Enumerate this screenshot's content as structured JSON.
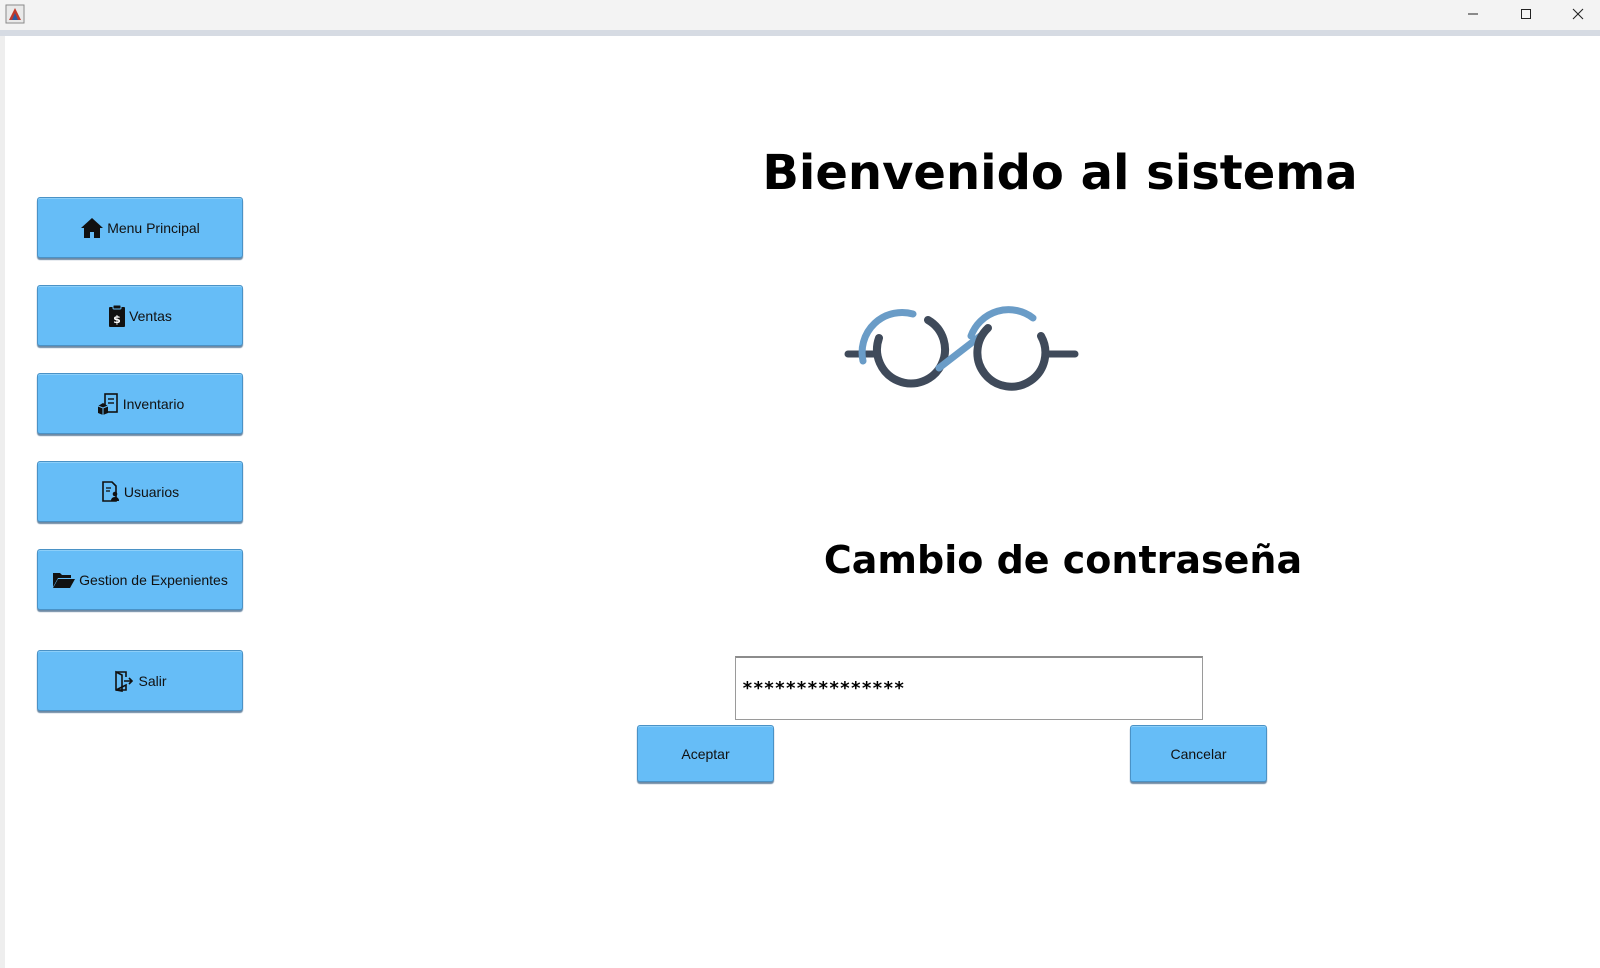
{
  "window": {
    "icons": {
      "app": "java-app-icon",
      "minimize": "minimize-icon",
      "maximize": "maximize-icon",
      "close": "close-icon"
    }
  },
  "sidebar": {
    "items": [
      {
        "label": "Menu Principal",
        "icon": "home-icon"
      },
      {
        "label": "Ventas",
        "icon": "clipboard-dollar-icon"
      },
      {
        "label": "Inventario",
        "icon": "inventory-icon"
      },
      {
        "label": "Usuarios",
        "icon": "user-document-icon"
      },
      {
        "label": "Gestion de Expenientes",
        "icon": "folder-open-icon"
      },
      {
        "label": "Salir",
        "icon": "exit-door-icon"
      }
    ]
  },
  "main": {
    "welcome_title": "Bienvenido al sistema",
    "logo_icon": "glasses-logo-icon",
    "section_title": "Cambio de contraseña",
    "password_value": "***************",
    "accept_label": "Aceptar",
    "cancel_label": "Cancelar"
  },
  "colors": {
    "button_fill": "#66bdf7",
    "button_border": "#4a92c6",
    "logo_dark": "#3f4a5a",
    "logo_light": "#6a9cc7"
  }
}
